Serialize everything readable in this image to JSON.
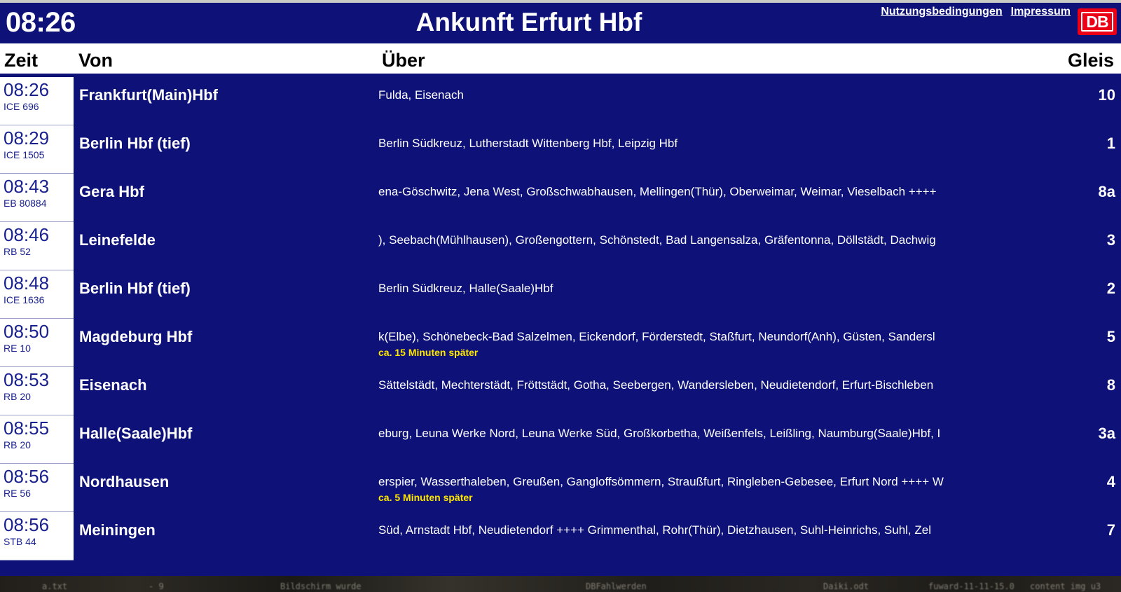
{
  "page": {
    "clock": "08:26",
    "title": "Ankunft Erfurt Hbf",
    "accent_blue": "#0d1178",
    "db_red": "#ec0016",
    "delay_yellow": "#ffe600"
  },
  "header": {
    "links": [
      {
        "label": "Nutzungsbedingungen"
      },
      {
        "label": "Impressum"
      }
    ],
    "logo_text": "DB"
  },
  "columns": {
    "zeit": "Zeit",
    "von": "Von",
    "ueber": "Über",
    "gleis": "Gleis"
  },
  "rows": [
    {
      "time": "08:26",
      "train": "ICE 696",
      "from": "Frankfurt(Main)Hbf",
      "via": "Fulda, Eisenach",
      "delay": "",
      "track": "10"
    },
    {
      "time": "08:29",
      "train": "ICE 1505",
      "from": "Berlin Hbf (tief)",
      "via": "Berlin Südkreuz, Lutherstadt Wittenberg Hbf, Leipzig Hbf",
      "delay": "",
      "track": "1"
    },
    {
      "time": "08:43",
      "train": "EB 80884",
      "from": "Gera Hbf",
      "via": "ena-Göschwitz, Jena West, Großschwabhausen, Mellingen(Thür), Oberweimar, Weimar, Vieselbach ++++",
      "delay": "",
      "track": "8a"
    },
    {
      "time": "08:46",
      "train": "RB 52",
      "from": "Leinefelde",
      "via": "), Seebach(Mühlhausen), Großengottern, Schönstedt, Bad Langensalza, Gräfentonna, Döllstädt, Dachwig",
      "delay": "",
      "track": "3"
    },
    {
      "time": "08:48",
      "train": "ICE 1636",
      "from": "Berlin Hbf (tief)",
      "via": "Berlin Südkreuz, Halle(Saale)Hbf",
      "delay": "",
      "track": "2"
    },
    {
      "time": "08:50",
      "train": "RE 10",
      "from": "Magdeburg Hbf",
      "via": "k(Elbe), Schönebeck-Bad Salzelmen, Eickendorf, Förderstedt, Staßfurt, Neundorf(Anh), Güsten, Sandersl",
      "delay": "ca. 15 Minuten später",
      "track": "5"
    },
    {
      "time": "08:53",
      "train": "RB 20",
      "from": "Eisenach",
      "via": "Sättelstädt, Mechterstädt, Fröttstädt, Gotha, Seebergen, Wandersleben, Neudietendorf, Erfurt-Bischleben",
      "delay": "",
      "track": "8"
    },
    {
      "time": "08:55",
      "train": "RB 20",
      "from": "Halle(Saale)Hbf",
      "via": "eburg, Leuna Werke Nord, Leuna Werke Süd, Großkorbetha, Weißenfels, Leißling, Naumburg(Saale)Hbf, I",
      "delay": "",
      "track": "3a"
    },
    {
      "time": "08:56",
      "train": "RE 56",
      "from": "Nordhausen",
      "via": "erspier, Wasserthaleben, Greußen, Gangloffsömmern, Straußfurt, Ringleben-Gebesee, Erfurt Nord ++++ W",
      "delay": "ca. 5 Minuten später",
      "track": "4"
    },
    {
      "time": "08:56",
      "train": "STB 44",
      "from": "Meiningen",
      "via": " Süd, Arnstadt Hbf, Neudietendorf ++++ Grimmenthal, Rohr(Thür), Dietzhausen, Suhl-Heinrichs, Suhl, Zel",
      "delay": "",
      "track": "7"
    }
  ],
  "background_window": {
    "fragments": [
      "a.txt",
      "- 9",
      "Bildschirm wurde",
      "DBFahlwerden",
      "Daiki.odt",
      "fuward-11-11-15.0",
      "content img u3"
    ]
  }
}
